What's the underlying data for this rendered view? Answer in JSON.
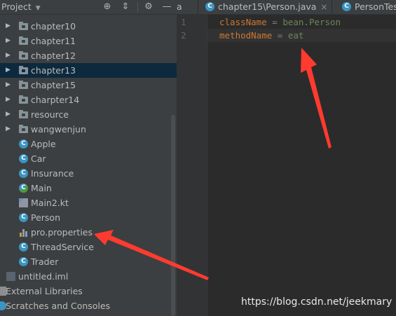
{
  "sidebar": {
    "title": "Project",
    "header_icons": [
      "crosshair-icon",
      "collapse-icon",
      "gear-icon",
      "minimize-icon"
    ],
    "items": [
      {
        "label": "chapter10",
        "type": "folder",
        "expandable": true
      },
      {
        "label": "chapter11",
        "type": "folder",
        "expandable": true
      },
      {
        "label": "chapter12",
        "type": "folder",
        "expandable": true
      },
      {
        "label": "chapter13",
        "type": "folder",
        "expandable": true,
        "selected": true
      },
      {
        "label": "chapter15",
        "type": "folder",
        "expandable": true
      },
      {
        "label": "charpter14",
        "type": "folder",
        "expandable": true
      },
      {
        "label": "resource",
        "type": "folder",
        "expandable": true
      },
      {
        "label": "wangwenjun",
        "type": "folder",
        "expandable": true
      },
      {
        "label": "Apple",
        "type": "class"
      },
      {
        "label": "Car",
        "type": "class"
      },
      {
        "label": "Insurance",
        "type": "class"
      },
      {
        "label": "Main",
        "type": "class-main"
      },
      {
        "label": "Main2.kt",
        "type": "kotlin"
      },
      {
        "label": "Person",
        "type": "class"
      },
      {
        "label": "pro.properties",
        "type": "properties"
      },
      {
        "label": "ThreadService",
        "type": "class"
      },
      {
        "label": "Trader",
        "type": "class"
      },
      {
        "label": "untitled.iml",
        "type": "iml"
      },
      {
        "label": "External Libraries",
        "type": "libraries"
      },
      {
        "label": "Scratches and Consoles",
        "type": "scratches"
      }
    ]
  },
  "tabs": [
    {
      "label": "a",
      "partial": true
    },
    {
      "label": "chapter15\\Person.java",
      "active": true
    },
    {
      "label": "PersonTest.ja",
      "partial": true
    }
  ],
  "tab_close_glyph": "×",
  "editor": {
    "lines": [
      {
        "number": "1",
        "key": "className",
        "sep": " = ",
        "value": "bean.Person"
      },
      {
        "number": "2",
        "key": "methodName",
        "sep": " = ",
        "value": "eat"
      }
    ]
  },
  "watermark": "https://blog.csdn.net/jeekmary",
  "colors": {
    "background": "#2b2b2b",
    "sidebar": "#3c3f41",
    "selection": "#0d293e",
    "property_key": "#cc7832",
    "property_value": "#6a8759",
    "annotation_arrow": "#ff3b2f"
  }
}
